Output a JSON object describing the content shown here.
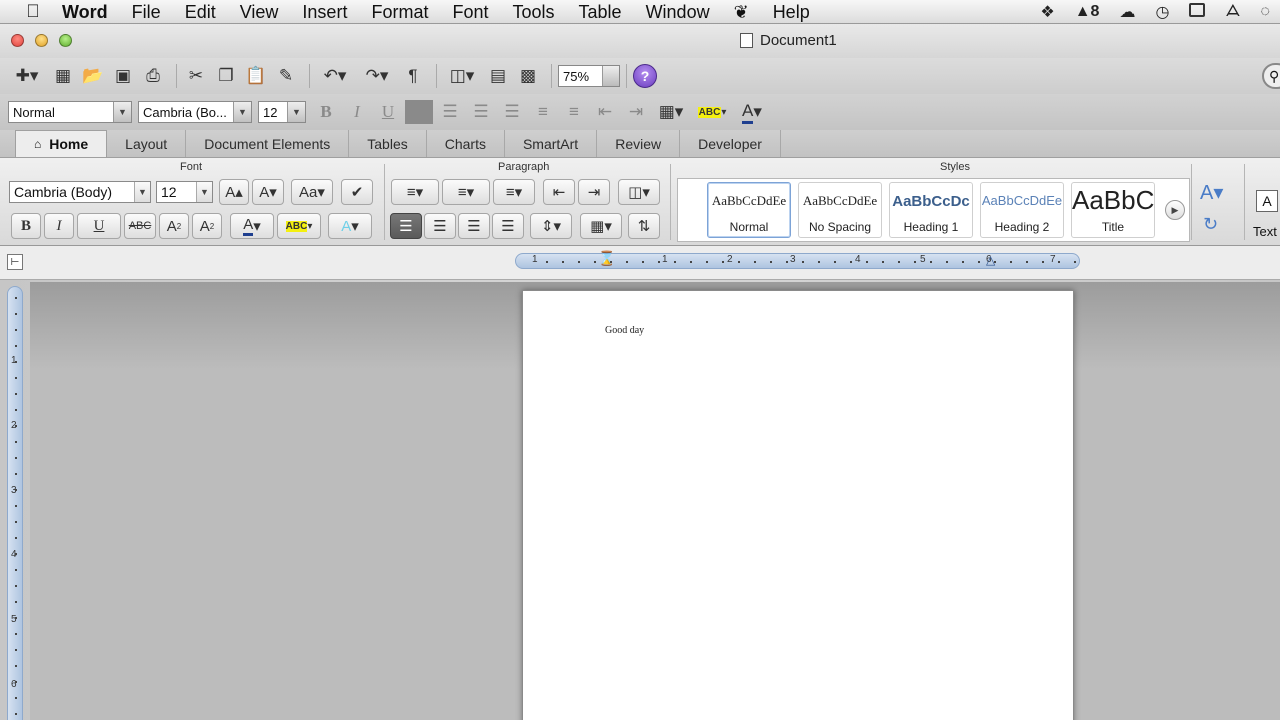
{
  "menubar": {
    "app": "Word",
    "items": [
      "File",
      "Edit",
      "View",
      "Insert",
      "Format",
      "Font",
      "Tools",
      "Table",
      "Window",
      "Help"
    ],
    "status_badge": "8"
  },
  "window": {
    "title": "Document1"
  },
  "toolbar": {
    "zoom": "75%",
    "help": "?"
  },
  "format_toolbar": {
    "style": "Normal",
    "font": "Cambria (Bo...",
    "size": "12",
    "abc": "ABC"
  },
  "tabs": [
    "Home",
    "Layout",
    "Document Elements",
    "Tables",
    "Charts",
    "SmartArt",
    "Review",
    "Developer"
  ],
  "ribbon": {
    "font_group": "Font",
    "paragraph_group": "Paragraph",
    "styles_group": "Styles",
    "font": "Cambria (Body)",
    "size": "12",
    "bold": "B",
    "italic": "I",
    "underline": "U",
    "strike": "ABC",
    "super": "A",
    "super_mark": "2",
    "sub": "A",
    "sub_mark": "2",
    "text_box": "Text",
    "styles": [
      {
        "sample": "AaBbCcDdEe",
        "name": "Normal"
      },
      {
        "sample": "AaBbCcDdEe",
        "name": "No Spacing"
      },
      {
        "sample": "AaBbCcDc",
        "name": "Heading 1"
      },
      {
        "sample": "AaBbCcDdEe",
        "name": "Heading 2"
      },
      {
        "sample": "AaBbC",
        "name": "Title"
      }
    ]
  },
  "ruler": {
    "h_numbers": [
      "1",
      "1",
      "2",
      "3",
      "4",
      "5",
      "6",
      "7"
    ],
    "v_numbers": [
      "1",
      "2",
      "3",
      "4",
      "5",
      "6"
    ]
  },
  "document": {
    "text": "Good day"
  }
}
